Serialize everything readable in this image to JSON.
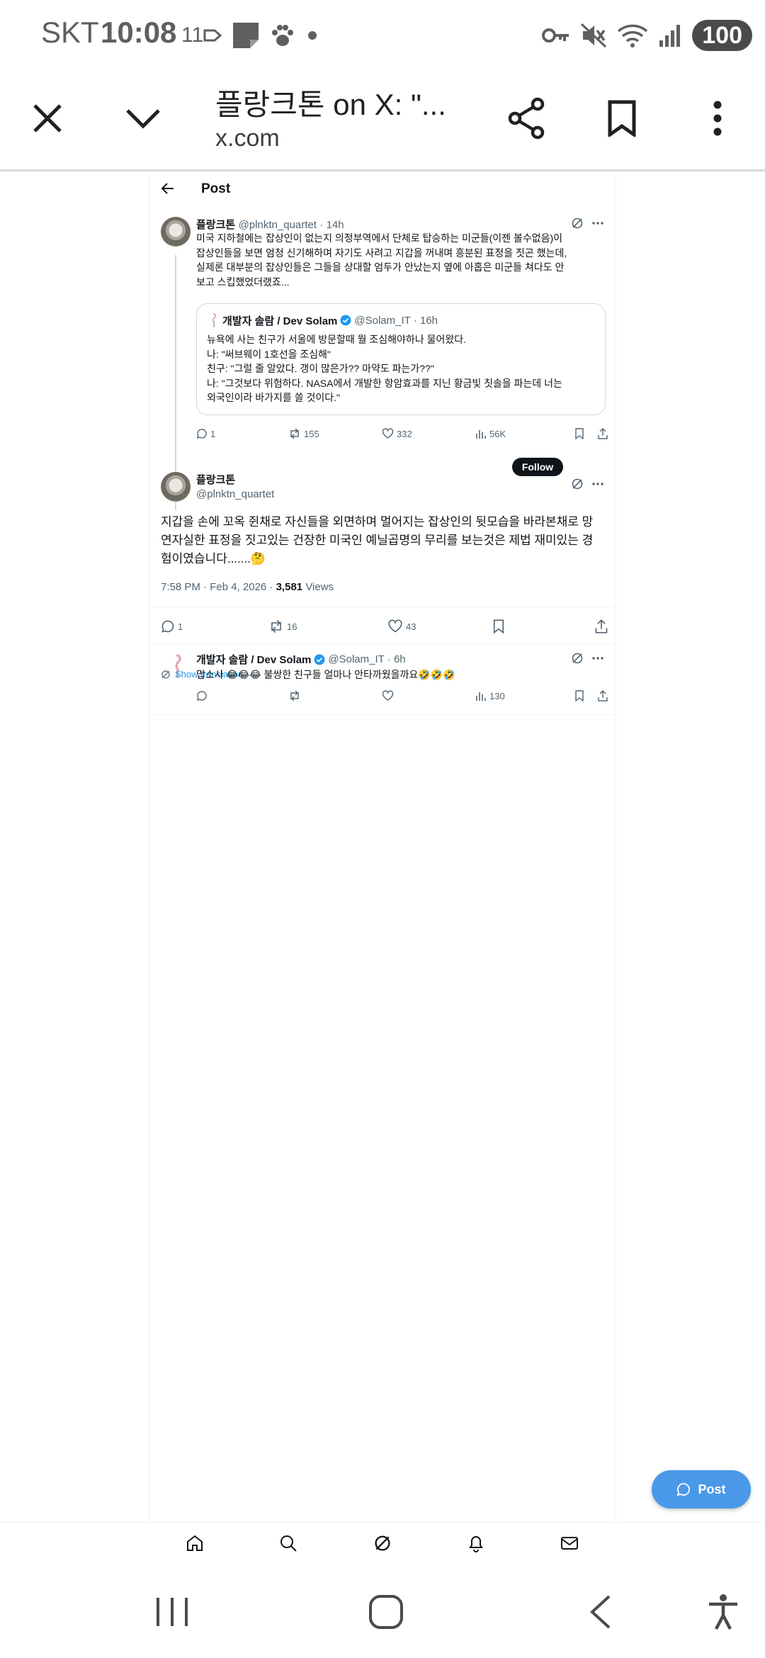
{
  "status_bar": {
    "carrier": "SKT",
    "time": "10:08",
    "notif_badge": "11",
    "battery": "100"
  },
  "toolbar": {
    "title": "플랑크톤 on X: \"...",
    "url": "x.com"
  },
  "page": {
    "header_title": "Post"
  },
  "parent_post": {
    "author": "플랑크톤",
    "handle": "@plnktn_quartet",
    "time": "· 14h",
    "text_lines": [
      "미국 지하철에는 잡상인이 없는지 의정부역에서 단체로 탑승하는 미군들(이젠 볼수없음)이",
      "잡상인들을 보면 엄청 신기해하며 자기도 사려고 지갑을 꺼내며 흥분된 표정을 짓곤 했는데,",
      "실제론 대부분의 잡상인들은 그들을 상대할 엄두가 안났는지 옆에 아홉은 미군들 쳐다도 안",
      "보고 스킵했었더랬죠..."
    ],
    "quote": {
      "author": "개발자 솔람 / Dev Solam",
      "handle": "@Solam_IT",
      "time": "· 16h",
      "lines": [
        "뉴욕에 사는 친구가 서울에 방문할때 뭘 조심해야하나 물어왔다.",
        "나: \"써브웨이 1호선을 조심해\"",
        "친구: \"그럴 줄 알았다. 갱이 많은가?? 마약도 파는가??\"",
        "나: \"그것보다 위험하다. NASA에서 개발한 항암효과를 지닌 황금빛 칫솔을 파는데 너는",
        "외국인이라 바가지를 쓸 것이다.\""
      ]
    },
    "replies": "1",
    "reposts": "155",
    "likes": "332",
    "views": "56K"
  },
  "main_post": {
    "author": "플랑크톤",
    "handle": "@plnktn_quartet",
    "follow_label": "Follow",
    "show_translation": "Show translation",
    "text_lines": [
      "지갑을 손에 꼬옥 쥔채로 자신들을 외면하며 멀어지는 잡상인의 뒷모습을 바라본채로 망",
      "연자실한 표정을 짓고있는 건장한 미국인 예닐곱명의 무리를 보는것은 제법 재미있는 경",
      "험이였습니다.......🤔"
    ],
    "timestamp": "7:58 PM · Feb 4, 2026 ·",
    "views_count": "3,581",
    "views_label": "Views",
    "replies": "1",
    "reposts": "16",
    "likes": "43"
  },
  "reply_post": {
    "author": "개발자 솔람 / Dev Solam",
    "handle": "@Solam_IT",
    "time": "· 6h",
    "text": "맙소사 😂😂😂 불쌍한 친구들 얼마나 안타까웠을까요🤣🤣🤣",
    "views": "130"
  },
  "fab": {
    "label": "Post"
  },
  "colors": {
    "accent": "#1d9bf0",
    "fab": "#4a99e9",
    "text": "#0f1419",
    "muted": "#536471"
  }
}
